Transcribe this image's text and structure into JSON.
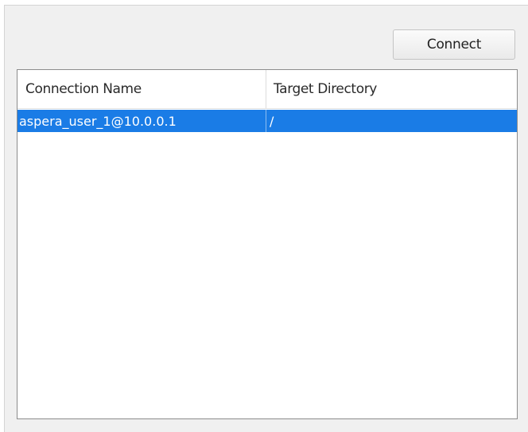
{
  "toolbar": {
    "connect_label": "Connect"
  },
  "table": {
    "columns": [
      "Connection Name",
      "Target Directory"
    ],
    "rows": [
      {
        "connection_name": "aspera_user_1@10.0.0.1",
        "target_directory": "/",
        "selected": true
      }
    ]
  },
  "colors": {
    "selection": "#1a7ce6",
    "panel_background": "#f0f0f0"
  }
}
